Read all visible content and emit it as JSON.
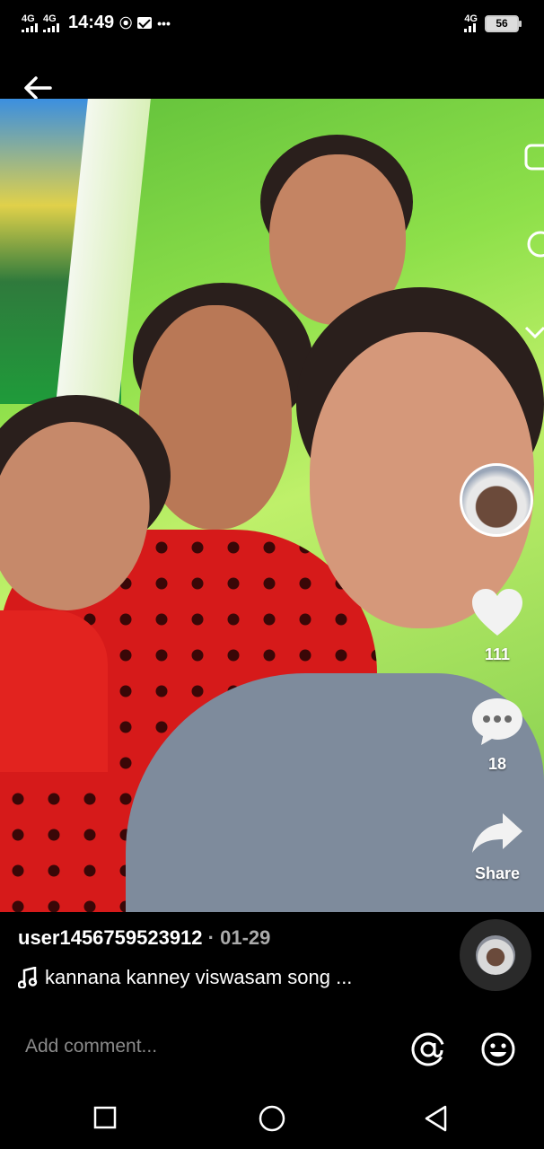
{
  "status_bar": {
    "network_1": "4G",
    "network_2": "4G",
    "time": "14:49",
    "right_network": "4G",
    "battery_level": "56"
  },
  "actions": {
    "like_count": "111",
    "comment_count": "18",
    "share_label": "Share"
  },
  "caption": {
    "username": "user1456759523912",
    "date": "· 01-29",
    "music": "kannana kanney viswasam song ..."
  },
  "comment_bar": {
    "placeholder": "Add comment..."
  },
  "colors": {
    "background": "#000000",
    "text": "#ffffff",
    "muted": "#8a8a8a"
  },
  "icons": [
    "back-arrow-icon",
    "heart-icon",
    "comment-bubble-icon",
    "share-arrow-icon",
    "music-note-icon",
    "at-icon",
    "emoji-icon",
    "recent-apps-icon",
    "home-icon",
    "back-nav-icon"
  ]
}
